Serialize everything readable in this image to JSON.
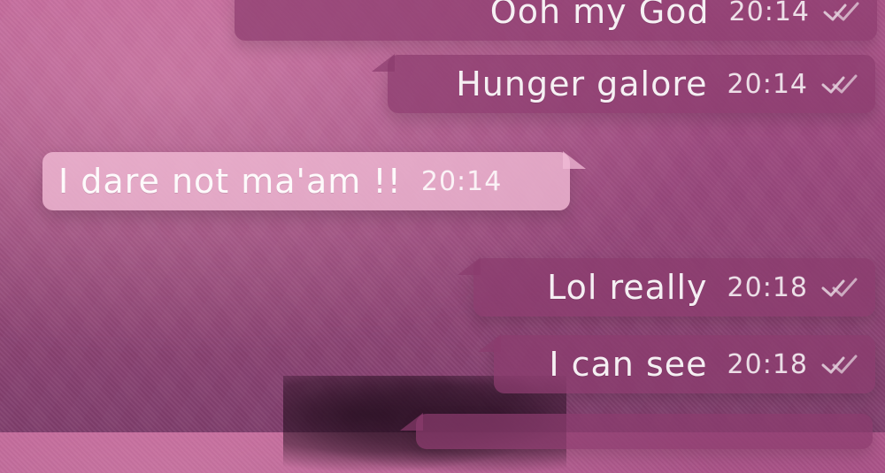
{
  "chat": {
    "messages": [
      {
        "direction": "out",
        "text": "Ooh my God",
        "time": "20:14",
        "status": "read"
      },
      {
        "direction": "out",
        "text": "Hunger galore",
        "time": "20:14",
        "status": "read"
      },
      {
        "direction": "in",
        "text": "I dare not ma'am !!",
        "time": "20:14"
      },
      {
        "direction": "out",
        "text": "Lol really",
        "time": "20:18",
        "status": "read"
      },
      {
        "direction": "out",
        "text": "I can see",
        "time": "20:18",
        "status": "read"
      }
    ]
  },
  "icons": {
    "read_receipt": "double-check-icon"
  },
  "colors": {
    "outgoing_bubble": "#8a3c6e",
    "incoming_bubble": "#f2bcd6",
    "background_top": "#b65b8f",
    "background_bottom": "#7f3d6b"
  }
}
